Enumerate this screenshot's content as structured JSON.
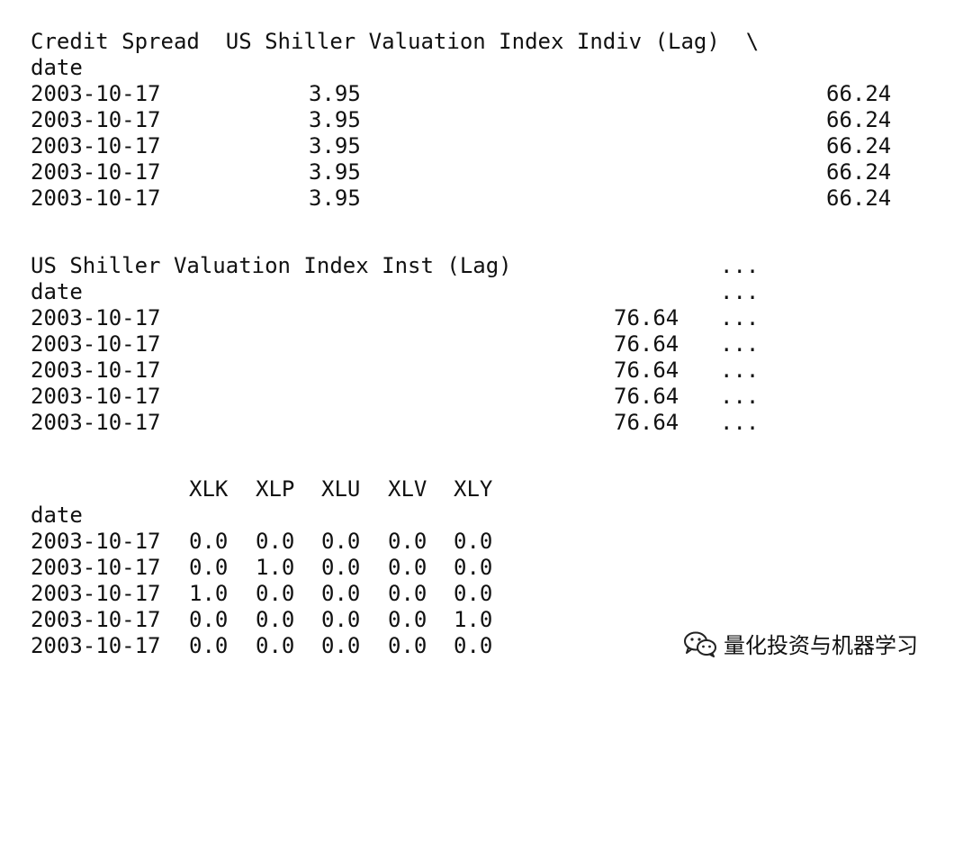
{
  "block1": {
    "header_line": "Credit Spread  US Shiller Valuation Index Indiv (Lag)  \\",
    "index_label": "date",
    "rows": [
      {
        "date": "2003-10-17",
        "credit_spread": "3.95",
        "indiv": "66.24"
      },
      {
        "date": "2003-10-17",
        "credit_spread": "3.95",
        "indiv": "66.24"
      },
      {
        "date": "2003-10-17",
        "credit_spread": "3.95",
        "indiv": "66.24"
      },
      {
        "date": "2003-10-17",
        "credit_spread": "3.95",
        "indiv": "66.24"
      },
      {
        "date": "2003-10-17",
        "credit_spread": "3.95",
        "indiv": "66.24"
      }
    ]
  },
  "block2": {
    "header_line": "US Shiller Valuation Index Inst (Lag)",
    "ellipsis": "...",
    "index_label": "date",
    "rows": [
      {
        "date": "2003-10-17",
        "inst": "76.64",
        "more": "..."
      },
      {
        "date": "2003-10-17",
        "inst": "76.64",
        "more": "..."
      },
      {
        "date": "2003-10-17",
        "inst": "76.64",
        "more": "..."
      },
      {
        "date": "2003-10-17",
        "inst": "76.64",
        "more": "..."
      },
      {
        "date": "2003-10-17",
        "inst": "76.64",
        "more": "..."
      }
    ]
  },
  "block3": {
    "columns": [
      "XLK",
      "XLP",
      "XLU",
      "XLV",
      "XLY"
    ],
    "index_label": "date",
    "rows": [
      {
        "date": "2003-10-17",
        "values": [
          "0.0",
          "0.0",
          "0.0",
          "0.0",
          "0.0"
        ]
      },
      {
        "date": "2003-10-17",
        "values": [
          "0.0",
          "1.0",
          "0.0",
          "0.0",
          "0.0"
        ]
      },
      {
        "date": "2003-10-17",
        "values": [
          "1.0",
          "0.0",
          "0.0",
          "0.0",
          "0.0"
        ]
      },
      {
        "date": "2003-10-17",
        "values": [
          "0.0",
          "0.0",
          "0.0",
          "0.0",
          "1.0"
        ]
      },
      {
        "date": "2003-10-17",
        "values": [
          "0.0",
          "0.0",
          "0.0",
          "0.0",
          "0.0"
        ]
      }
    ]
  },
  "watermark": {
    "text": "量化投资与机器学习",
    "icon": "wechat-icon"
  }
}
